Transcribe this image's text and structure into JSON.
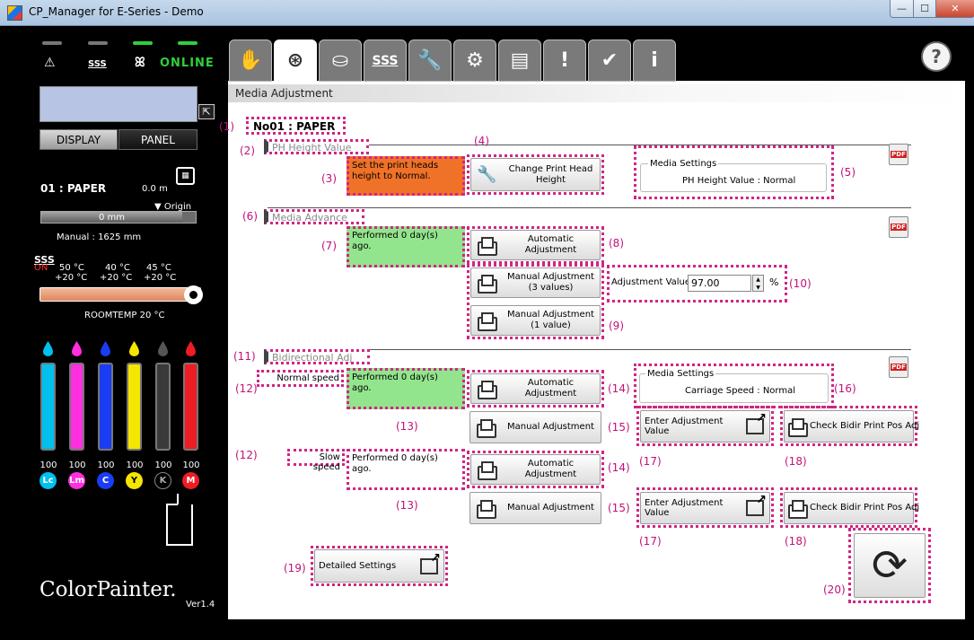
{
  "window": {
    "title": "CP_Manager for E-Series - Demo",
    "min": "—",
    "max": "☐",
    "close": "✕"
  },
  "left": {
    "status_icons": [
      "⚠",
      "SSS",
      "ꕤ"
    ],
    "online": "ONLINE",
    "display_btn": "DISPLAY",
    "panel_btn": "PANEL",
    "media_name": "01 : PAPER",
    "media_pos": "0.0  m",
    "origin": "▼ Origin",
    "gauge_text": "0   mm",
    "manual_len": "Manual : 1625  mm",
    "heater": {
      "on": "ON",
      "temps": [
        "50 °C",
        "40 °C",
        "45 °C"
      ],
      "offsets": [
        "+20 °C",
        "+20 °C",
        "+20 °C"
      ],
      "room": "ROOMTEMP   20 °C"
    },
    "inks": [
      {
        "name": "Lc",
        "level": "100",
        "color": "#00c0ee"
      },
      {
        "name": "Lm",
        "level": "100",
        "color": "#ff2ee0"
      },
      {
        "name": "C",
        "level": "100",
        "color": "#1a3cf2"
      },
      {
        "name": "Y",
        "level": "100",
        "color": "#f5e600"
      },
      {
        "name": "K",
        "level": "100",
        "color": "#555555"
      },
      {
        "name": "M",
        "level": "100",
        "color": "#ee1c24"
      }
    ],
    "logo": "ColorPainter.",
    "version": "Ver1.4"
  },
  "tabs": [
    "✋",
    "⊛",
    "⛀",
    "SSS",
    "🔧",
    "⚙",
    "▤",
    "!",
    "✔",
    "i"
  ],
  "help": "?",
  "main": {
    "header": "Media Adjustment",
    "media": "No01  : PAPER",
    "notes": [
      "(1)",
      "(2)",
      "(3)",
      "(4)",
      "(5)",
      "(6)",
      "(7)",
      "(8)",
      "(9)",
      "(10)",
      "(11)",
      "(12)",
      "(12)",
      "(13)",
      "(13)",
      "(14)",
      "(14)",
      "(15)",
      "(15)",
      "(16)",
      "(17)",
      "(17)",
      "(18)",
      "(18)",
      "(19)",
      "(20)"
    ],
    "ph": {
      "title": "PH Height Value",
      "status": "Set the print heads height to Normal.",
      "change_btn": "Change Print Head Height",
      "settings_title": "Media Settings",
      "settings_value": "PH Height Value   :  Normal"
    },
    "advance": {
      "title": "Media Advance",
      "status": "Performed 0 day(s) ago.",
      "auto_btn": "Automatic Adjustment",
      "manual3_btn": "Manual Adjustment (3 values)",
      "manual1_btn": "Manual Adjustment (1 value)",
      "adj_label": "Adjustment Value",
      "adj_value": "97.00",
      "adj_unit": "%"
    },
    "bidir": {
      "title": "Bidirectional Adj",
      "normal_label": "Normal speed",
      "slow_label": "Slow speed",
      "normal_status": "Performed 0 day(s) ago.",
      "slow_status": "Performed 0 day(s) ago.",
      "auto_btn": "Automatic Adjustment",
      "manual_btn": "Manual Adjustment",
      "settings_title": "Media Settings",
      "settings_value": "Carriage Speed   :  Normal",
      "enter_btn": "Enter Adjustment Value",
      "check_btn": "Check Bidir Print Pos Adj"
    },
    "detailed_btn": "Detailed Settings",
    "refresh": "⟳"
  }
}
